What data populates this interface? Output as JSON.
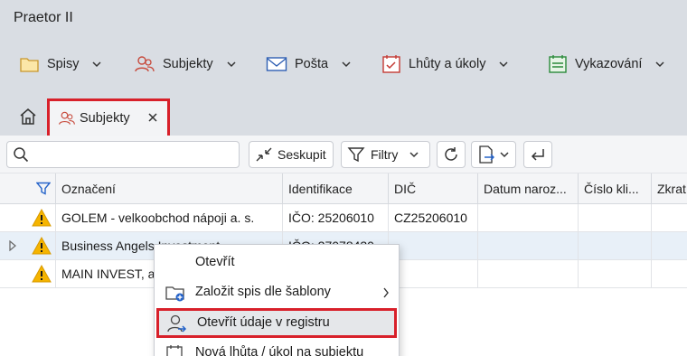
{
  "app": {
    "title": "Praetor II"
  },
  "menu": {
    "items": [
      {
        "label": "Spisy",
        "icon": "folder-icon"
      },
      {
        "label": "Subjekty",
        "icon": "people-icon"
      },
      {
        "label": "Pošta",
        "icon": "envelope-icon"
      },
      {
        "label": "Lhůty a úkoly",
        "icon": "calendar-check-icon"
      },
      {
        "label": "Vykazování",
        "icon": "timesheet-icon"
      }
    ]
  },
  "tabs": {
    "home_icon": "home-icon",
    "active": {
      "label": "Subjekty",
      "icon": "people-icon"
    }
  },
  "toolbar": {
    "search": {
      "placeholder": "",
      "value": ""
    },
    "group_label": "Seskupit",
    "filter_label": "Filtry"
  },
  "grid": {
    "columns": [
      "Označení",
      "Identifikace",
      "DIČ",
      "Datum naroz...",
      "Číslo kli...",
      "Zkrat"
    ],
    "rows": [
      {
        "name": "GOLEM - velkoobchod nápoji a. s.",
        "id": "IČO: 25206010",
        "dic": "CZ25206010",
        "warning": true
      },
      {
        "name": "Business Angels Investment",
        "id": "IČO: 27078430",
        "dic": "",
        "warning": true
      },
      {
        "name": "MAIN INVEST, a",
        "id": "",
        "dic": "",
        "warning": true
      }
    ]
  },
  "context_menu": {
    "items": [
      {
        "label": "Otevřít"
      },
      {
        "label": "Založit spis dle šablony",
        "icon": "folder-add-icon"
      },
      {
        "label": "Otevřít údaje v registru",
        "icon": "person-arrow-icon"
      },
      {
        "label": "Nová lhůta / úkol na subjektu",
        "icon": "calendar-task-icon"
      }
    ]
  },
  "colors": {
    "highlight_border": "#d8202a",
    "accent_blue": "#2563c9",
    "warning": "#f5b400"
  }
}
